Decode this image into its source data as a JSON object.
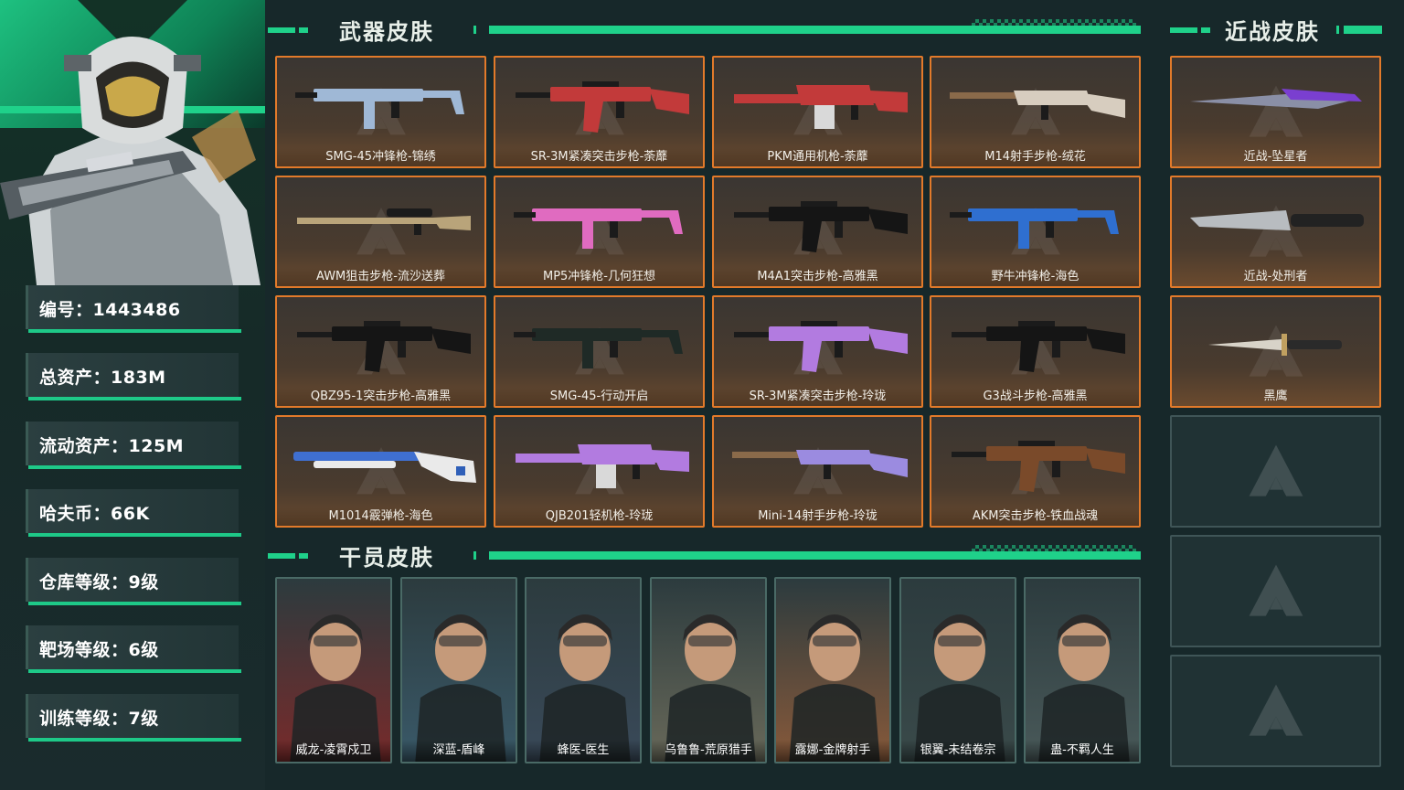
{
  "profile": {
    "stats": [
      {
        "label": "编号：1443486"
      },
      {
        "label": "总资产：183M"
      },
      {
        "label": "流动资产：125M"
      },
      {
        "label": "哈夫币：66K"
      },
      {
        "label": "仓库等级：9级"
      },
      {
        "label": "靶场等级：6级"
      },
      {
        "label": "训练等级：7级"
      }
    ]
  },
  "sections": {
    "weapons_title": "武器皮肤",
    "melee_title": "近战皮肤",
    "operators_title": "干员皮肤"
  },
  "weapons": [
    {
      "name": "SMG-45冲锋枪-锦绣",
      "icon": "smg-icon",
      "color": "#9fb8d6"
    },
    {
      "name": "SR-3M紧凑突击步枪-荼蘼",
      "icon": "rifle-icon",
      "color": "#c23a3a"
    },
    {
      "name": "PKM通用机枪-荼蘼",
      "icon": "lmg-icon",
      "color": "#c23a3a"
    },
    {
      "name": "M14射手步枪-绒花",
      "icon": "marksman-icon",
      "color": "#d7cdbf"
    },
    {
      "name": "AWM狙击步枪-流沙送葬",
      "icon": "sniper-icon",
      "color": "#b9a47a"
    },
    {
      "name": "MP5冲锋枪-几何狂想",
      "icon": "smg-icon",
      "color": "#e06bc0"
    },
    {
      "name": "M4A1突击步枪-高雅黑",
      "icon": "rifle-icon",
      "color": "#151515"
    },
    {
      "name": "野牛冲锋枪-海色",
      "icon": "smg-icon",
      "color": "#2f6fd0"
    },
    {
      "name": "QBZ95-1突击步枪-高雅黑",
      "icon": "rifle-icon",
      "color": "#151515"
    },
    {
      "name": "SMG-45-行动开启",
      "icon": "smg-icon",
      "color": "#1f2a26"
    },
    {
      "name": "SR-3M紧凑突击步枪-玲珑",
      "icon": "rifle-icon",
      "color": "#b27be0"
    },
    {
      "name": "G3战斗步枪-高雅黑",
      "icon": "rifle-icon",
      "color": "#151515"
    },
    {
      "name": "M1014霰弹枪-海色",
      "icon": "shotgun-icon",
      "color": "#eaeaea"
    },
    {
      "name": "QJB201轻机枪-玲珑",
      "icon": "lmg-icon",
      "color": "#b27be0"
    },
    {
      "name": "Mini-14射手步枪-玲珑",
      "icon": "marksman-icon",
      "color": "#9b8be0"
    },
    {
      "name": "AKM突击步枪-铁血战魂",
      "icon": "rifle-icon",
      "color": "#7a4a2a"
    }
  ],
  "melee": [
    {
      "name": "近战-坠星者",
      "icon": "blade-icon"
    },
    {
      "name": "近战-处刑者",
      "icon": "knife-icon"
    },
    {
      "name": "黑鹰",
      "icon": "dagger-icon"
    }
  ],
  "operators": [
    {
      "name": "威龙-凌霄戍卫",
      "color": "#7a2a2a"
    },
    {
      "name": "深蓝-盾峰",
      "color": "#3a5a6a"
    },
    {
      "name": "蜂医-医生",
      "color": "#3a4a5a"
    },
    {
      "name": "乌鲁鲁-荒原猎手",
      "color": "#6a6a5a"
    },
    {
      "name": "露娜-金牌射手",
      "color": "#8a5a3a"
    },
    {
      "name": "银翼-未结卷宗",
      "color": "#3a4a4a"
    },
    {
      "name": "蛊-不羁人生",
      "color": "#4a5a5a"
    }
  ]
}
